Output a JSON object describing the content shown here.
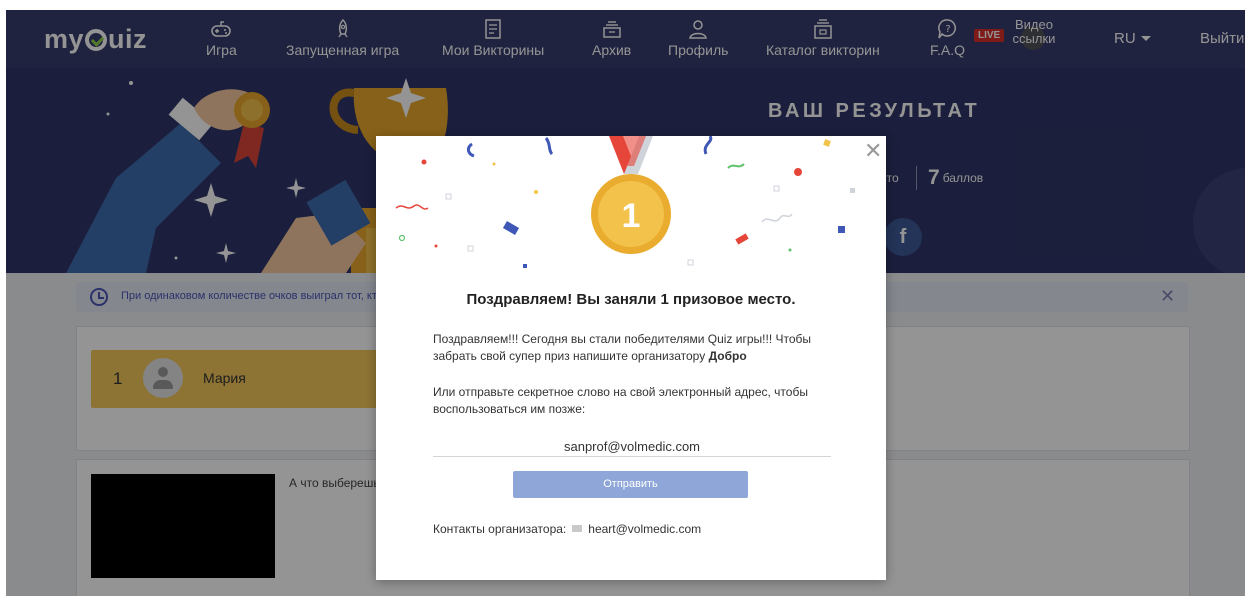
{
  "nav": {
    "logo": "myQuiz",
    "items": [
      {
        "label": "Игра",
        "icon": "gamepad-icon"
      },
      {
        "label": "Запущенная игра",
        "icon": "rocket-icon"
      },
      {
        "label": "Мои Викторины",
        "icon": "document-icon"
      },
      {
        "label": "Архив",
        "icon": "archive-icon"
      },
      {
        "label": "Профиль",
        "icon": "user-icon"
      },
      {
        "label": "Каталог викторин",
        "icon": "catalog-icon"
      },
      {
        "label": "F.A.Q",
        "icon": "question-bubble-icon"
      }
    ],
    "live_badge": "LIVE",
    "video_links": "Видео ссылки",
    "language": "RU",
    "logout": "Выйти"
  },
  "hero": {
    "title": "ВАШ РЕЗУЛЬТАТ",
    "place_text": "есто",
    "score_value": "7",
    "score_unit": "баллов",
    "facebook_letter": "f"
  },
  "info_bar": {
    "text": "При одинаковом количестве очков выиграл тот, кт"
  },
  "leaderboard": {
    "place": "1",
    "name": "Мария"
  },
  "question": {
    "text": "А что выберешь"
  },
  "modal": {
    "medal_number": "1",
    "title": "Поздравляем! Вы заняли 1 призовое место.",
    "message": "Поздравляем!!! Сегодня вы стали победителями Quiz игры!!! Чтобы забрать свой супер приз напишите организатору",
    "message_bold": "Добро",
    "secret_prompt": "Или отправьте секретное слово на свой электронный адрес, чтобы воспользоваться им позже:",
    "email_value": "sanprof@volmedic.com",
    "send_label": "Отправить",
    "contacts_label": "Контакты организатора:",
    "contacts_email": "heart@volmedic.com"
  },
  "colors": {
    "nav_bg": "#383d6e",
    "hero_bg": "#2f3568",
    "winner_gold": "#f3c85b",
    "send_button": "#8fa7d8",
    "info_text": "#4a56b5"
  }
}
